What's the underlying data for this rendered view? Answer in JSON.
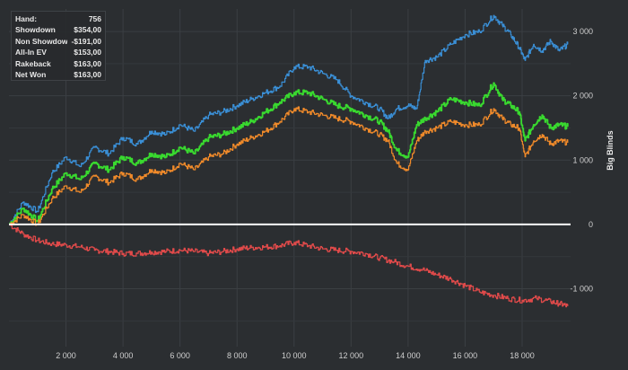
{
  "stats": [
    {
      "label": "Hand:",
      "value": "756"
    },
    {
      "label": "Showdown",
      "value": "$354,00"
    },
    {
      "label": "Non Showdown",
      "value": "-$191,00"
    },
    {
      "label": "All-In EV",
      "value": "$153,00"
    },
    {
      "label": "Rakeback",
      "value": "$163,00"
    },
    {
      "label": "Net Won",
      "value": "$163,00"
    }
  ],
  "chart_data": {
    "type": "line",
    "xlabel": "",
    "ylabel": "Big Blinds",
    "xlim": [
      0,
      19700
    ],
    "ylim": [
      -1900,
      3350
    ],
    "x_ticks": [
      2000,
      4000,
      6000,
      8000,
      10000,
      12000,
      14000,
      16000,
      18000
    ],
    "x_tick_labels": [
      "2 000",
      "4 000",
      "6 000",
      "8 000",
      "10 000",
      "12 000",
      "14 000",
      "16 000",
      "18 000"
    ],
    "y_ticks": [
      -1000,
      0,
      1000,
      2000,
      3000
    ],
    "y_tick_labels": [
      "-1 000",
      "0",
      "1 000",
      "2 000",
      "3 000"
    ],
    "grid": true,
    "zero_line_color": "#ffffff",
    "series": [
      {
        "color": "#3a8fd6",
        "x": [
          0,
          500,
          1000,
          1500,
          2000,
          2500,
          3000,
          3500,
          4000,
          4500,
          5000,
          5500,
          6000,
          6500,
          7000,
          7500,
          8000,
          8500,
          9000,
          9500,
          10000,
          10500,
          11000,
          11500,
          12000,
          12500,
          13000,
          13300,
          13600,
          14000,
          14300,
          14600,
          15000,
          15500,
          16000,
          16500,
          17000,
          17300,
          17600,
          17900,
          18100,
          18400,
          18700,
          19000,
          19300,
          19600
        ],
        "y": [
          0,
          350,
          200,
          800,
          1050,
          900,
          1200,
          1100,
          1350,
          1250,
          1450,
          1400,
          1550,
          1450,
          1700,
          1750,
          1850,
          1950,
          2050,
          2150,
          2450,
          2450,
          2350,
          2250,
          2000,
          1900,
          1800,
          1650,
          1800,
          1850,
          1800,
          2550,
          2600,
          2800,
          2950,
          3000,
          3250,
          3100,
          2950,
          2750,
          2550,
          2800,
          2700,
          2850,
          2700,
          2800
        ]
      },
      {
        "color": "#39d92f",
        "x": [
          0,
          500,
          1000,
          1500,
          2000,
          2500,
          3000,
          3500,
          4000,
          4500,
          5000,
          5500,
          6000,
          6500,
          7000,
          7500,
          8000,
          8500,
          9000,
          9500,
          10000,
          10500,
          11000,
          11500,
          12000,
          12500,
          13000,
          13300,
          13600,
          14000,
          14300,
          14600,
          15000,
          15500,
          16000,
          16500,
          17000,
          17300,
          17600,
          17900,
          18100,
          18400,
          18700,
          19000,
          19300,
          19600
        ],
        "y": [
          0,
          250,
          50,
          550,
          800,
          700,
          950,
          850,
          1050,
          950,
          1100,
          1050,
          1200,
          1100,
          1350,
          1400,
          1500,
          1600,
          1750,
          1900,
          2050,
          2050,
          1950,
          1850,
          1800,
          1700,
          1600,
          1450,
          1150,
          1050,
          1550,
          1650,
          1750,
          1950,
          1900,
          1850,
          2200,
          1950,
          1850,
          1750,
          1300,
          1550,
          1700,
          1500,
          1550,
          1520
        ]
      },
      {
        "color": "#f08a2a",
        "x": [
          0,
          500,
          1000,
          1500,
          2000,
          2500,
          3000,
          3500,
          4000,
          4500,
          5000,
          5500,
          6000,
          6500,
          7000,
          7500,
          8000,
          8500,
          9000,
          9500,
          10000,
          10500,
          11000,
          11500,
          12000,
          12500,
          13000,
          13300,
          13600,
          14000,
          14300,
          14600,
          15000,
          15500,
          16000,
          16500,
          17000,
          17300,
          17600,
          17900,
          18100,
          18400,
          18700,
          19000,
          19300,
          19600
        ],
        "y": [
          0,
          150,
          0,
          400,
          600,
          500,
          750,
          650,
          800,
          700,
          850,
          800,
          950,
          850,
          1050,
          1100,
          1250,
          1350,
          1450,
          1600,
          1800,
          1750,
          1700,
          1650,
          1600,
          1500,
          1400,
          1300,
          950,
          850,
          1300,
          1450,
          1500,
          1600,
          1550,
          1550,
          1800,
          1650,
          1550,
          1500,
          1050,
          1300,
          1400,
          1250,
          1300,
          1270
        ]
      },
      {
        "color": "#e04a4a",
        "x": [
          0,
          500,
          1000,
          1500,
          2000,
          2500,
          3000,
          3500,
          4000,
          4500,
          5000,
          5500,
          6000,
          6500,
          7000,
          7500,
          8000,
          8500,
          9000,
          9500,
          10000,
          10500,
          11000,
          11500,
          12000,
          12500,
          13000,
          13500,
          14000,
          14500,
          15000,
          15500,
          16000,
          16500,
          17000,
          17500,
          18000,
          18500,
          19000,
          19300,
          19600
        ],
        "y": [
          0,
          -150,
          -250,
          -300,
          -320,
          -350,
          -400,
          -420,
          -450,
          -450,
          -430,
          -420,
          -400,
          -420,
          -450,
          -420,
          -380,
          -360,
          -350,
          -330,
          -280,
          -330,
          -380,
          -400,
          -420,
          -450,
          -520,
          -580,
          -650,
          -700,
          -780,
          -850,
          -950,
          -1050,
          -1100,
          -1150,
          -1180,
          -1150,
          -1200,
          -1230,
          -1270
        ]
      }
    ]
  }
}
